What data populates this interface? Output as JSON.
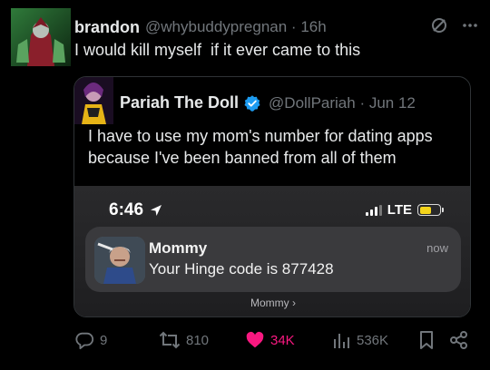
{
  "tweet": {
    "author": {
      "display_name": "brandon",
      "handle": "@whybuddypregnan",
      "time": "16h"
    },
    "text": "I would kill myself  if it ever came to this",
    "icons": [
      "grok-icon",
      "more-icon"
    ]
  },
  "quoted_tweet": {
    "author": {
      "display_name": "Pariah The Doll",
      "verified": true,
      "handle": "@DollPariah",
      "date": "Jun 12"
    },
    "text": "I have to use my mom's number for dating apps because I've been banned from all of them",
    "screenshot": {
      "status_time": "6:46",
      "network": "LTE",
      "battery_color": "#f4d41b",
      "notification": {
        "title": "Mommy",
        "body": "Your Hinge code is 877428",
        "time": "now",
        "group_label": "Mommy"
      }
    }
  },
  "actions": {
    "replies": "9",
    "retweets": "810",
    "likes": "34K",
    "views": "536K",
    "like_color": "#f91880"
  }
}
